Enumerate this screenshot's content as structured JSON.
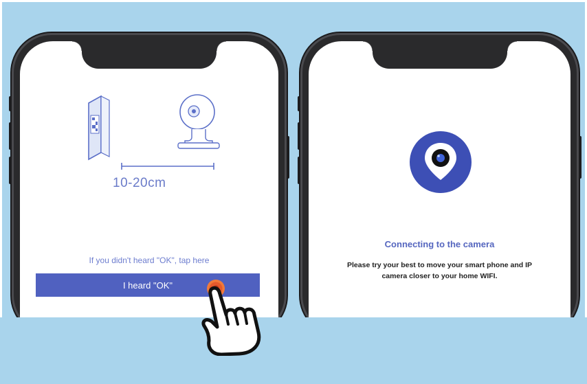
{
  "left_screen": {
    "distance": "10-20cm",
    "hint_link": "If you didn't heard \"OK\", tap here",
    "button_label": "I heard \"OK\""
  },
  "right_screen": {
    "title": "Connecting to the camera",
    "body": "Please try your best to move your smart phone and IP camera closer to your home WIFI."
  },
  "colors": {
    "background": "#a9d4ec",
    "accent": "#5061c0",
    "tap_highlight": "#e45a2c"
  },
  "icons": [
    "qr-code-icon",
    "camera-icon",
    "location-pin-icon",
    "pointing-hand-icon"
  ]
}
